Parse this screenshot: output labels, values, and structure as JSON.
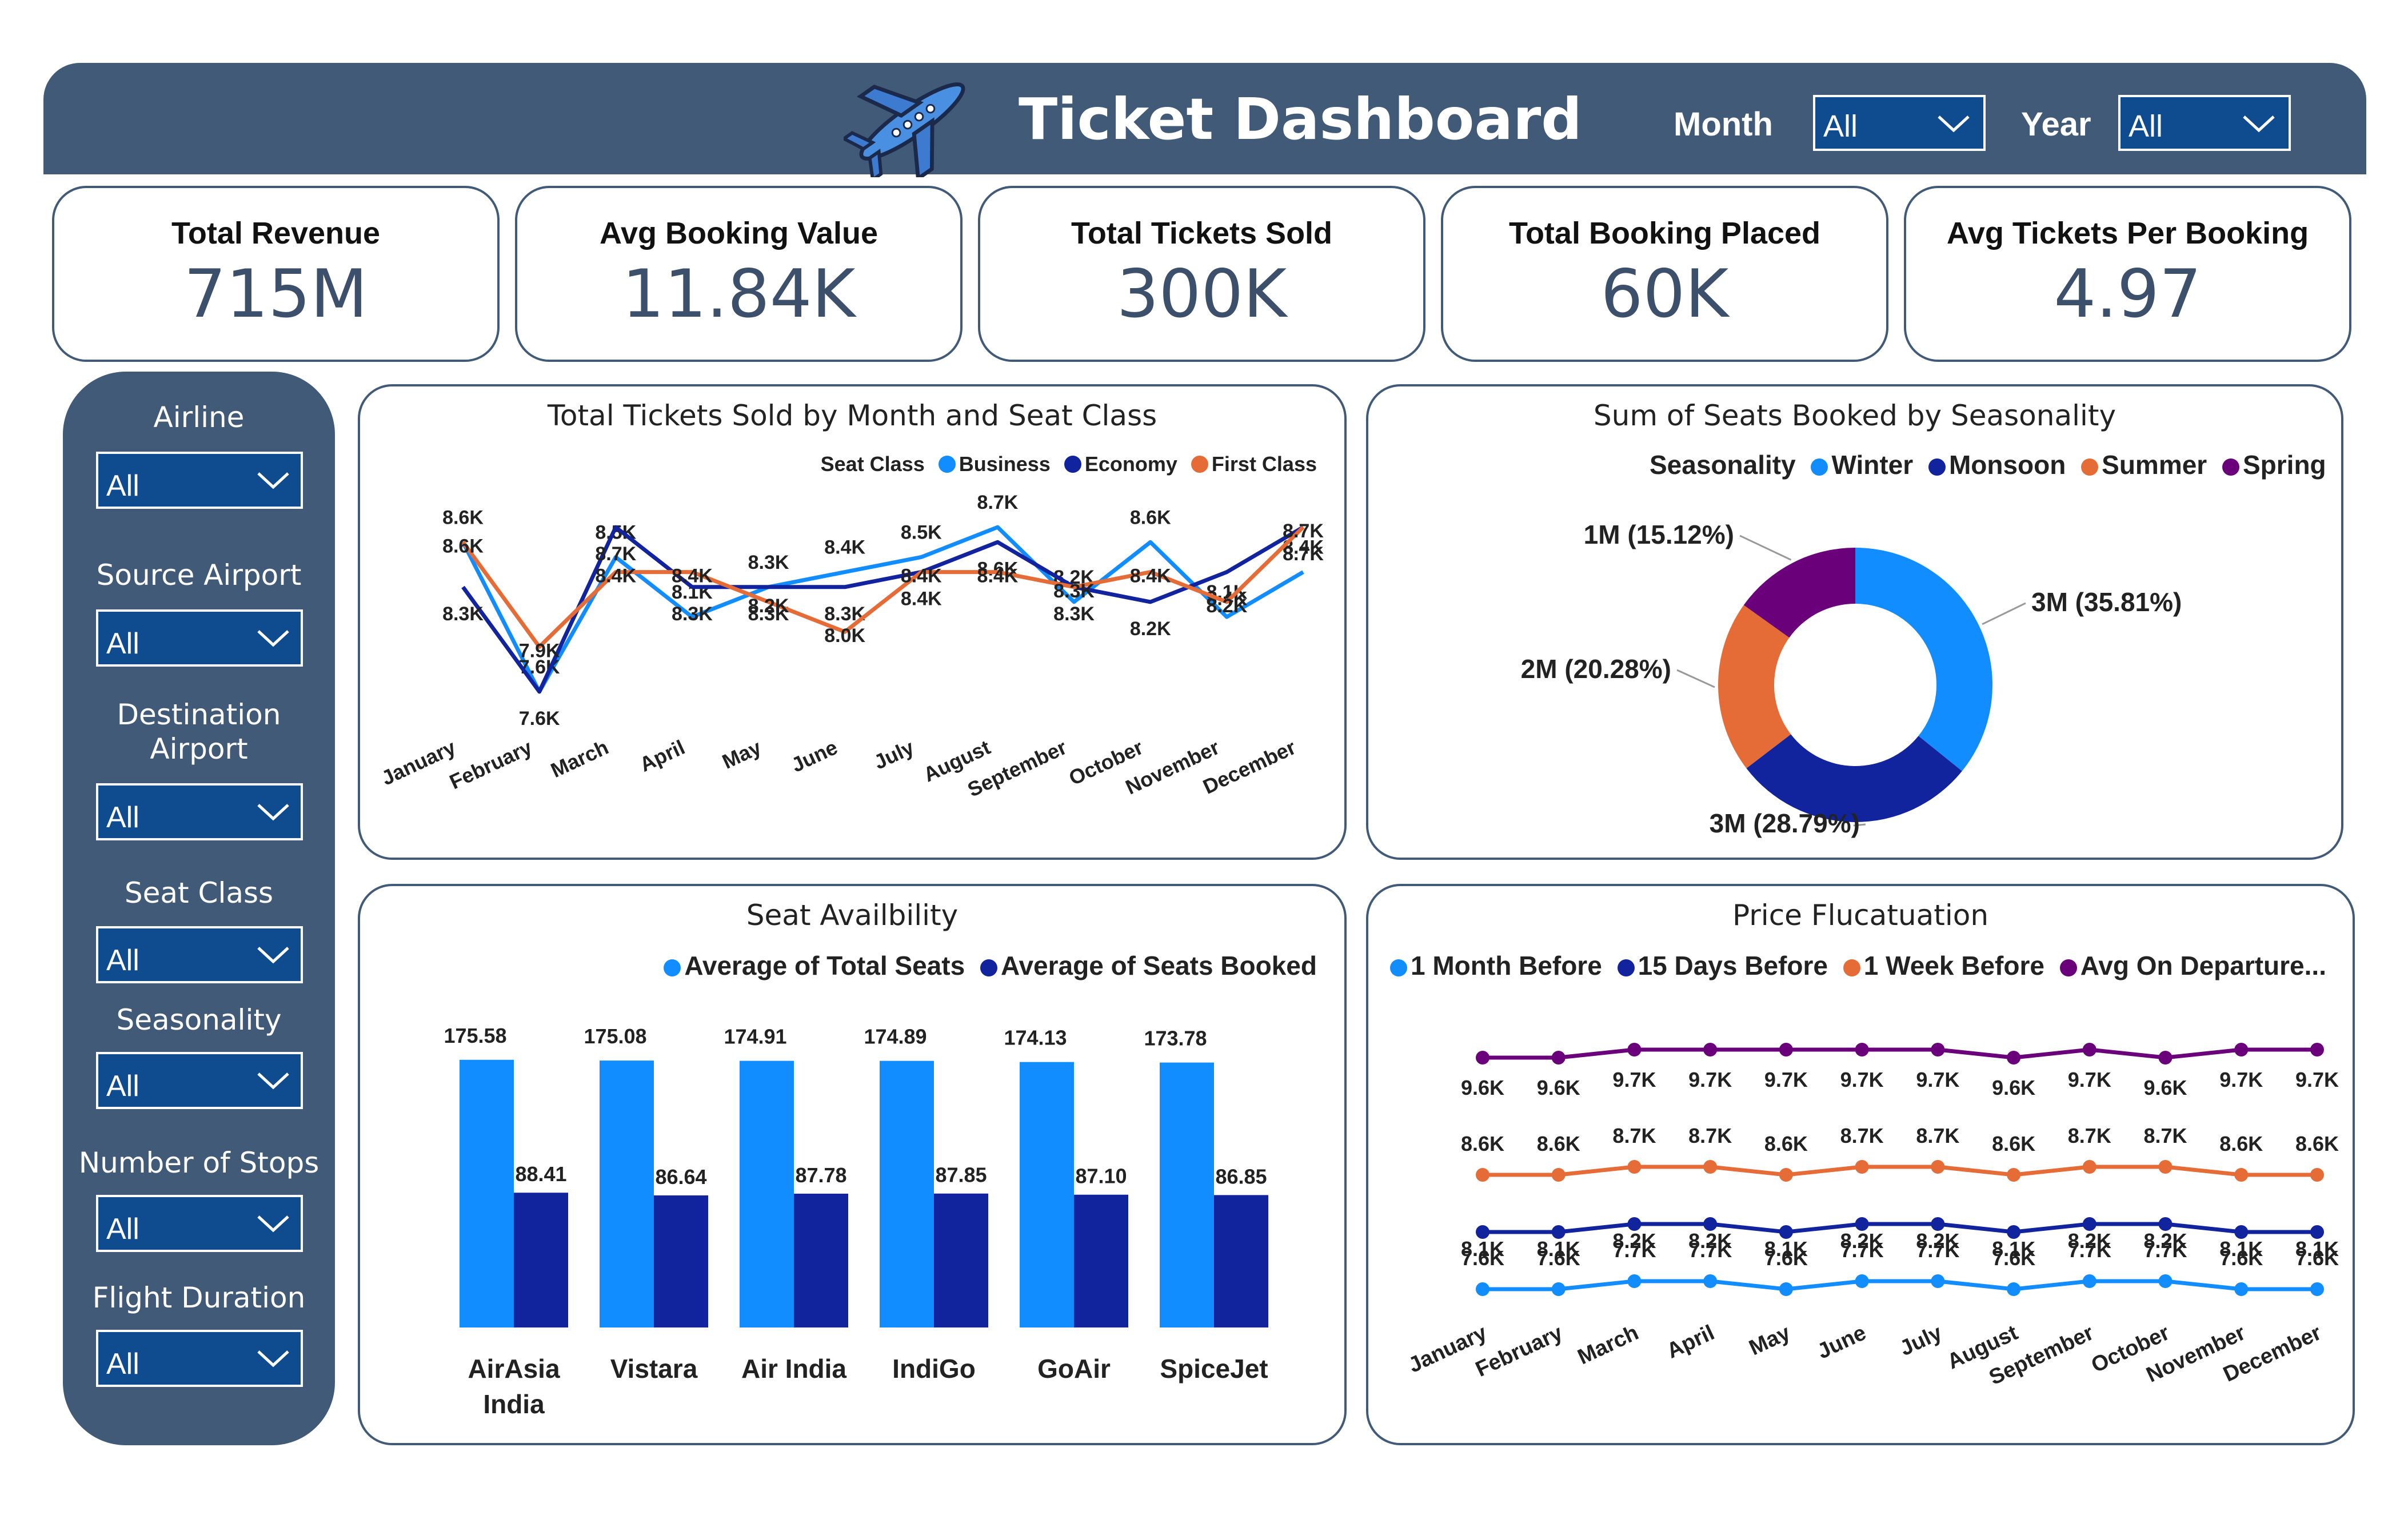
{
  "header": {
    "title": "Ticket Dashboard",
    "month_label": "Month",
    "month_value": "All",
    "year_label": "Year",
    "year_value": "All",
    "icon": "airplane-icon",
    "bg_color": "#415a78"
  },
  "kpis": [
    {
      "title": "Total Revenue",
      "value": "715M"
    },
    {
      "title": "Avg Booking Value",
      "value": "11.84K"
    },
    {
      "title": "Total Tickets Sold",
      "value": "300K"
    },
    {
      "title": "Total Booking Placed",
      "value": "60K"
    },
    {
      "title": "Avg Tickets Per Booking",
      "value": "4.97"
    }
  ],
  "filters": [
    {
      "label": "Airline",
      "value": "All"
    },
    {
      "label": "Source Airport",
      "value": "All"
    },
    {
      "label": "Destination Airport",
      "value": "All"
    },
    {
      "label": "Seat Class",
      "value": "All"
    },
    {
      "label": "Seasonality",
      "value": "All"
    },
    {
      "label": "Number of Stops",
      "value": "All"
    },
    {
      "label": "Flight Duration",
      "value": "All"
    }
  ],
  "chart_data": [
    {
      "type": "line",
      "title": "Total Tickets Sold by Month and Seat Class",
      "legend_title": "Seat Class",
      "categories": [
        "January",
        "February",
        "March",
        "April",
        "May",
        "June",
        "July",
        "August",
        "September",
        "October",
        "November",
        "December"
      ],
      "series": [
        {
          "name": "Business",
          "color": "#118dff",
          "values": [
            8600,
            7600,
            8500,
            8100,
            8300,
            8400,
            8500,
            8700,
            8200,
            8600,
            8100,
            8400
          ],
          "labels": [
            "8.6K",
            "7.6K",
            "8.5K",
            "8.1K",
            "8.3K",
            "8.4K",
            "8.5K",
            "8.7K",
            "8.2K",
            "8.6K",
            "8.1K",
            "8.4K"
          ]
        },
        {
          "name": "Economy",
          "color": "#12239e",
          "values": [
            8300,
            7600,
            8700,
            8300,
            8300,
            8300,
            8400,
            8600,
            8300,
            8200,
            8400,
            8700
          ],
          "labels": [
            "8.3K",
            "7.6K",
            "8.7K",
            "8.3K",
            "8.3K",
            "8.3K",
            "8.4K",
            "8.6K",
            "8.3K",
            "8.2K",
            "8.4K",
            "8.7K"
          ]
        },
        {
          "name": "First Class",
          "color": "#e66c37",
          "values": [
            8600,
            7900,
            8400,
            8400,
            8200,
            8000,
            8400,
            8400,
            8300,
            8400,
            8200,
            8700
          ],
          "labels": [
            "8.6K",
            "7.9K",
            "8.4K",
            "8.4K",
            "8.2K",
            "8.0K",
            "8.4K",
            "8.4K",
            "8.3K",
            "8.4K",
            "8.2K",
            "8.7K"
          ]
        }
      ]
    },
    {
      "type": "pie",
      "title": "Sum of Seats Booked by Seasonality",
      "legend_title": "Seasonality",
      "slices": [
        {
          "name": "Winter",
          "value": 35.81,
          "label": "3M (35.81%)",
          "color": "#118dff"
        },
        {
          "name": "Monsoon",
          "value": 28.79,
          "label": "3M (28.79%)",
          "color": "#12239e"
        },
        {
          "name": "Summer",
          "value": 20.28,
          "label": "2M (20.28%)",
          "color": "#e66c37"
        },
        {
          "name": "Spring",
          "value": 15.12,
          "label": "1M (15.12%)",
          "color": "#6b007b"
        }
      ]
    },
    {
      "type": "bar",
      "title": "Seat Availbility",
      "categories": [
        "AirAsia India",
        "Vistara",
        "Air India",
        "IndiGo",
        "GoAir",
        "SpiceJet"
      ],
      "series": [
        {
          "name": "Average of Total Seats",
          "color": "#118dff",
          "values": [
            175.58,
            175.08,
            174.91,
            174.89,
            174.13,
            173.78
          ]
        },
        {
          "name": "Average of Seats Booked",
          "color": "#12239e",
          "values": [
            88.41,
            86.64,
            87.78,
            87.85,
            87.1,
            86.85
          ]
        }
      ]
    },
    {
      "type": "line",
      "title": "Price Flucatuation",
      "categories": [
        "January",
        "February",
        "March",
        "April",
        "May",
        "June",
        "July",
        "August",
        "September",
        "October",
        "November",
        "December"
      ],
      "series": [
        {
          "name": "1 Month Before",
          "color": "#118dff",
          "values": [
            7600,
            7600,
            7700,
            7700,
            7600,
            7700,
            7700,
            7600,
            7700,
            7700,
            7600,
            7600
          ],
          "labels": [
            "7.6K",
            "7.6K",
            "7.7K",
            "7.7K",
            "7.6K",
            "7.7K",
            "7.7K",
            "7.6K",
            "7.7K",
            "7.7K",
            "7.6K",
            "7.6K"
          ]
        },
        {
          "name": "15 Days Before",
          "color": "#12239e",
          "values": [
            8100,
            8100,
            8200,
            8200,
            8100,
            8200,
            8200,
            8100,
            8200,
            8200,
            8100,
            8100
          ],
          "labels": [
            "8.1K",
            "8.1K",
            "8.2K",
            "8.2K",
            "8.1K",
            "8.2K",
            "8.2K",
            "8.1K",
            "8.2K",
            "8.2K",
            "8.1K",
            "8.1K"
          ]
        },
        {
          "name": "1 Week Before",
          "color": "#e66c37",
          "values": [
            8600,
            8600,
            8700,
            8700,
            8600,
            8700,
            8700,
            8600,
            8700,
            8700,
            8600,
            8600
          ],
          "labels": [
            "8.6K",
            "8.6K",
            "8.7K",
            "8.7K",
            "8.6K",
            "8.7K",
            "8.7K",
            "8.6K",
            "8.7K",
            "8.7K",
            "8.6K",
            "8.6K"
          ]
        },
        {
          "name": "Avg On Departure...",
          "color": "#6b007b",
          "values": [
            9600,
            9600,
            9700,
            9700,
            9700,
            9700,
            9700,
            9600,
            9700,
            9600,
            9700,
            9700
          ],
          "labels": [
            "9.6K",
            "9.6K",
            "9.7K",
            "9.7K",
            "9.7K",
            "9.7K",
            "9.7K",
            "9.6K",
            "9.7K",
            "9.6K",
            "9.7K",
            "9.7K"
          ]
        }
      ]
    }
  ]
}
